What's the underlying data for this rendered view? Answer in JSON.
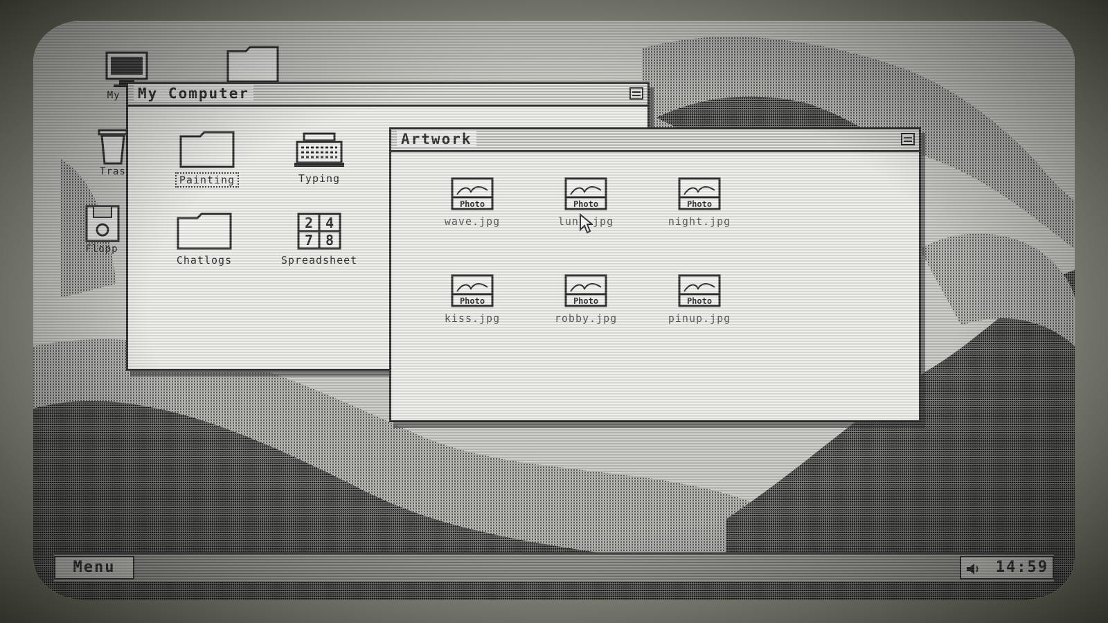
{
  "desktop": {
    "icons": [
      {
        "label": "My Com",
        "icon": "monitor-icon"
      },
      {
        "label": "",
        "icon": "folder-icon"
      },
      {
        "label": "Tras",
        "icon": "trash-icon"
      },
      {
        "label": "Flopp",
        "icon": "floppy-icon"
      }
    ]
  },
  "my_computer": {
    "title": "My Computer",
    "items": [
      {
        "label": "Painting",
        "icon": "folder-icon",
        "selected": true
      },
      {
        "label": "Typing",
        "icon": "typewriter-icon"
      },
      {
        "label": "Chatlogs",
        "icon": "folder-icon"
      },
      {
        "label": "Spreadsheet",
        "icon": "spreadsheet-icon",
        "digits": [
          "2",
          "4",
          "7",
          "8"
        ]
      }
    ]
  },
  "artwork": {
    "title": "Artwork",
    "photo_badge": "Photo",
    "files": [
      {
        "label": "wave.jpg"
      },
      {
        "label": "luna.jpg"
      },
      {
        "label": "night.jpg"
      },
      {
        "label": "kiss.jpg"
      },
      {
        "label": "robby.jpg"
      },
      {
        "label": "pinup.jpg"
      }
    ]
  },
  "taskbar": {
    "menu_label": "Menu",
    "clock": "14:59",
    "tray_icon": "speaker-icon"
  },
  "colors": {
    "ink": "#2a2a2a",
    "window_bg": "#eeeeea",
    "screen_bg": "#bdbdb8"
  }
}
